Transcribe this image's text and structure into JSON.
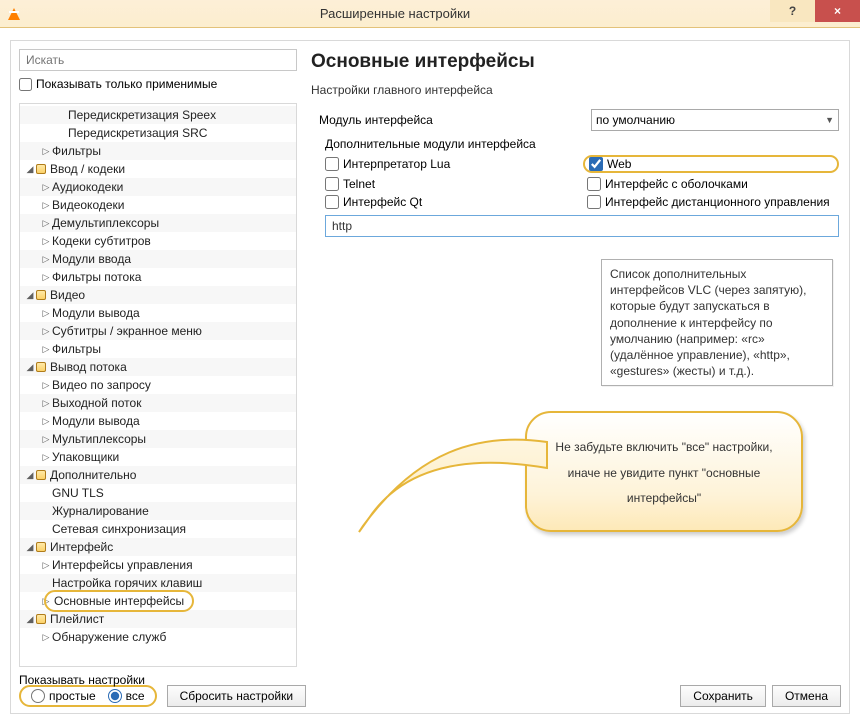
{
  "window": {
    "title": "Расширенные настройки",
    "help": "?",
    "close": "×"
  },
  "search": {
    "placeholder": "Искать"
  },
  "only_applicable_label": "Показывать только применимые",
  "tree": [
    {
      "d": 2,
      "t": "",
      "l": "Передискретизация Speex"
    },
    {
      "d": 2,
      "t": "",
      "l": "Передискретизация SRC"
    },
    {
      "d": 1,
      "t": "▷",
      "l": "Фильтры"
    },
    {
      "d": 0,
      "t": "◢",
      "i": true,
      "l": "Ввод / кодеки"
    },
    {
      "d": 1,
      "t": "▷",
      "l": "Аудиокодеки"
    },
    {
      "d": 1,
      "t": "▷",
      "l": "Видеокодеки"
    },
    {
      "d": 1,
      "t": "▷",
      "l": "Демультиплексоры"
    },
    {
      "d": 1,
      "t": "▷",
      "l": "Кодеки субтитров"
    },
    {
      "d": 1,
      "t": "▷",
      "l": "Модули ввода"
    },
    {
      "d": 1,
      "t": "▷",
      "l": "Фильтры потока"
    },
    {
      "d": 0,
      "t": "◢",
      "i": true,
      "l": "Видео"
    },
    {
      "d": 1,
      "t": "▷",
      "l": "Модули вывода"
    },
    {
      "d": 1,
      "t": "▷",
      "l": "Субтитры / экранное меню"
    },
    {
      "d": 1,
      "t": "▷",
      "l": "Фильтры"
    },
    {
      "d": 0,
      "t": "◢",
      "i": true,
      "l": "Вывод потока"
    },
    {
      "d": 1,
      "t": "▷",
      "l": "Видео по запросу"
    },
    {
      "d": 1,
      "t": "▷",
      "l": "Выходной поток"
    },
    {
      "d": 1,
      "t": "▷",
      "l": "Модули вывода"
    },
    {
      "d": 1,
      "t": "▷",
      "l": "Мультиплексоры"
    },
    {
      "d": 1,
      "t": "▷",
      "l": "Упаковщики"
    },
    {
      "d": 0,
      "t": "◢",
      "i": true,
      "l": "Дополнительно"
    },
    {
      "d": 1,
      "t": "",
      "l": "GNU TLS"
    },
    {
      "d": 1,
      "t": "",
      "l": "Журналирование"
    },
    {
      "d": 1,
      "t": "",
      "l": "Сетевая синхронизация"
    },
    {
      "d": 0,
      "t": "◢",
      "i": true,
      "l": "Интерфейс"
    },
    {
      "d": 1,
      "t": "▷",
      "l": "Интерфейсы управления"
    },
    {
      "d": 1,
      "t": "",
      "l": "Настройка горячих клавиш"
    },
    {
      "d": 1,
      "t": "▷",
      "l": "Основные интерфейсы",
      "hl": true
    },
    {
      "d": 0,
      "t": "◢",
      "i": true,
      "l": "Плейлист"
    },
    {
      "d": 1,
      "t": "▷",
      "l": "Обнаружение служб"
    }
  ],
  "right": {
    "heading": "Основные интерфейсы",
    "sub": "Настройки главного интерфейса",
    "module_label": "Модуль интерфейса",
    "module_value": "по умолчанию",
    "addon_label": "Дополнительные модули интерфейса",
    "cb": {
      "lua": "Интерпретатор Lua",
      "web": "Web",
      "telnet": "Telnet",
      "skins": "Интерфейс с оболочками",
      "qt": "Интерфейс Qt",
      "remote": "Интерфейс дистанционного управления"
    },
    "text_value": "http"
  },
  "tooltip": "Список дополнительных интерфейсов VLC (через запятую), которые будут запускаться в дополнение к интерфейсу по умолчанию (например: «rc» (удалённое управление), «http», «gestures» (жесты) и т.д.).",
  "callout": "Не забудьте включить \"все\" настройки, иначе не увидите пункт \"основные интерфейсы\"",
  "bottom": {
    "show_label": "Показывать настройки",
    "simple": "простые",
    "all": "все",
    "reset": "Сбросить настройки",
    "save": "Сохранить",
    "cancel": "Отмена"
  }
}
